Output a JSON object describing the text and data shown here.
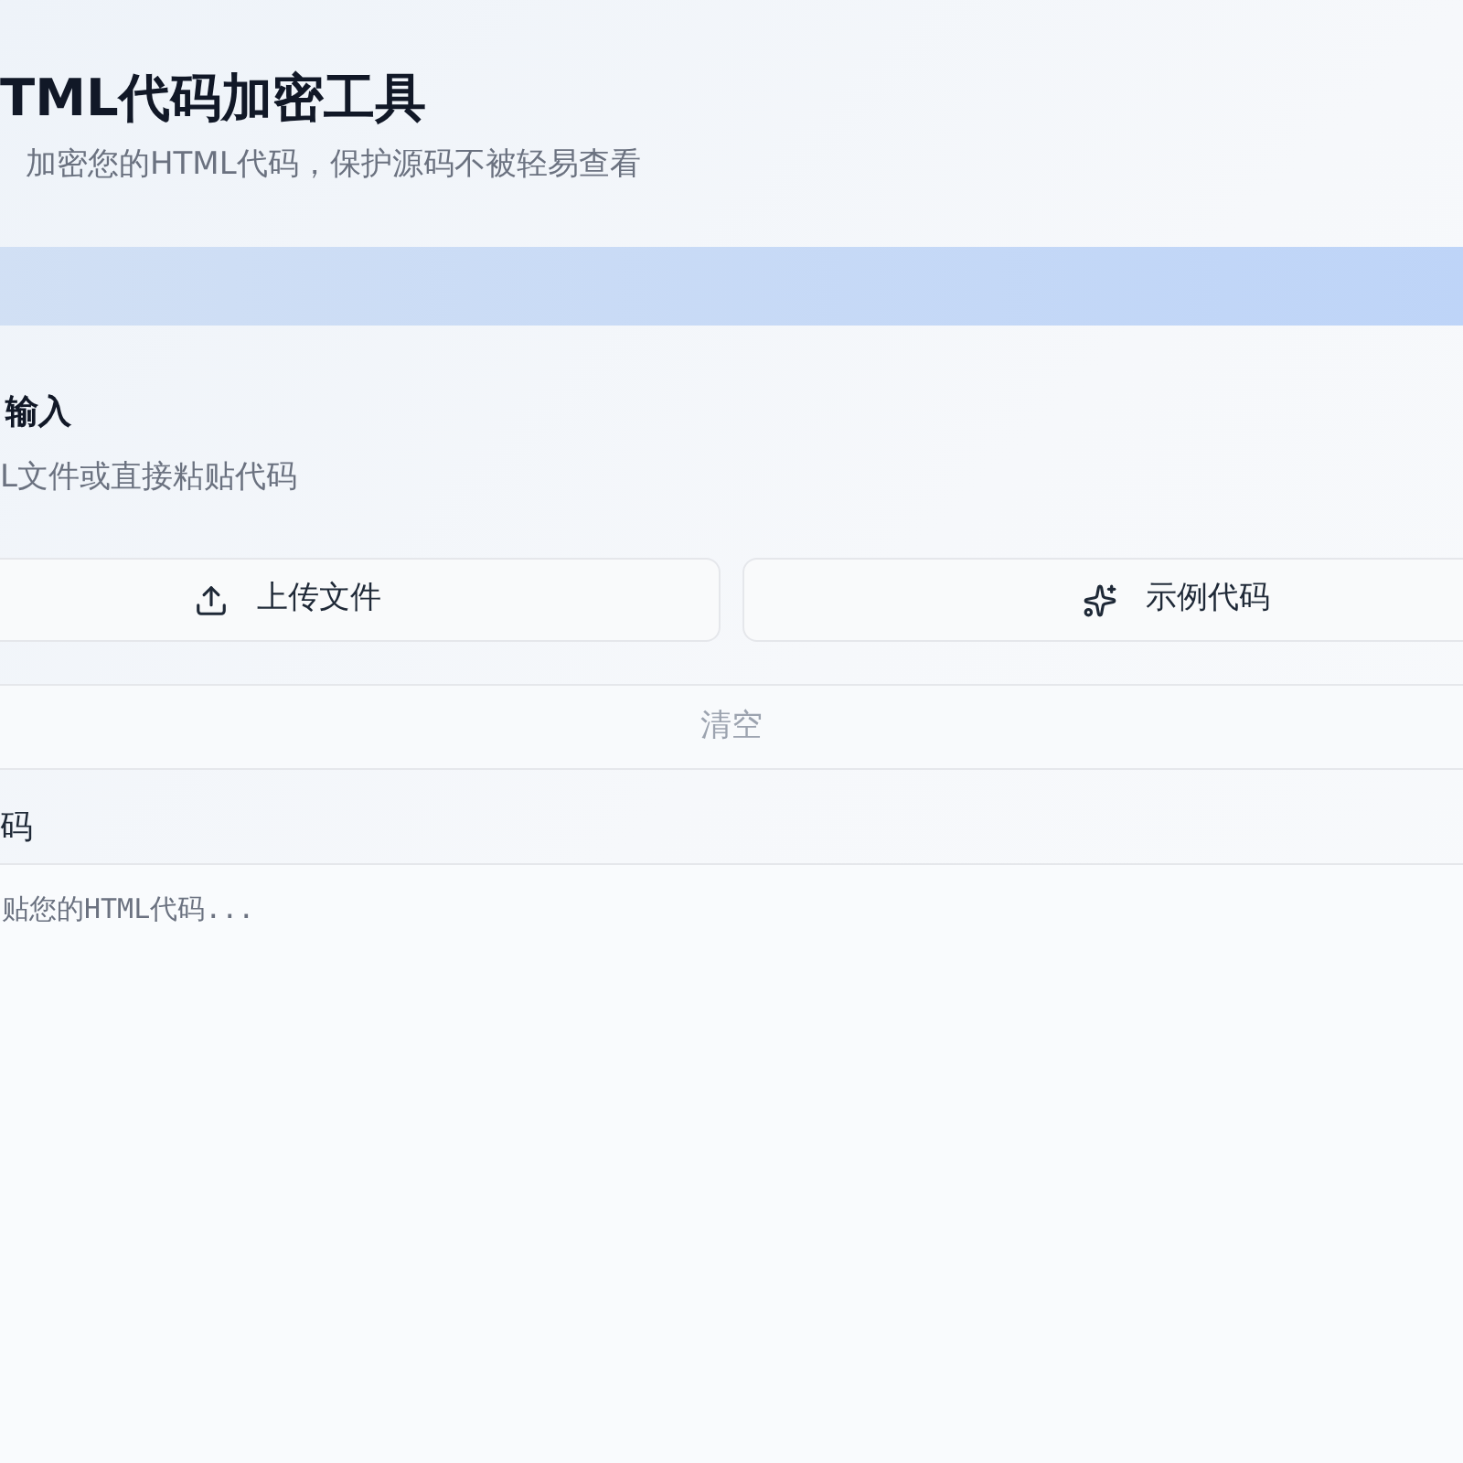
{
  "header": {
    "title": "TML代码加密工具",
    "subtitle": "加密您的HTML代码，保护源码不被轻易查看"
  },
  "input_panel": {
    "title": "输入",
    "description": "L文件或直接粘贴代码",
    "actions": [
      {
        "kind": "upload",
        "label": "上传文件"
      },
      {
        "kind": "example",
        "label": "示例代码"
      }
    ],
    "clear_button": "清空",
    "code_label": "码",
    "code_field": {
      "placeholder": "贴您的HTML代码..."
    }
  }
}
